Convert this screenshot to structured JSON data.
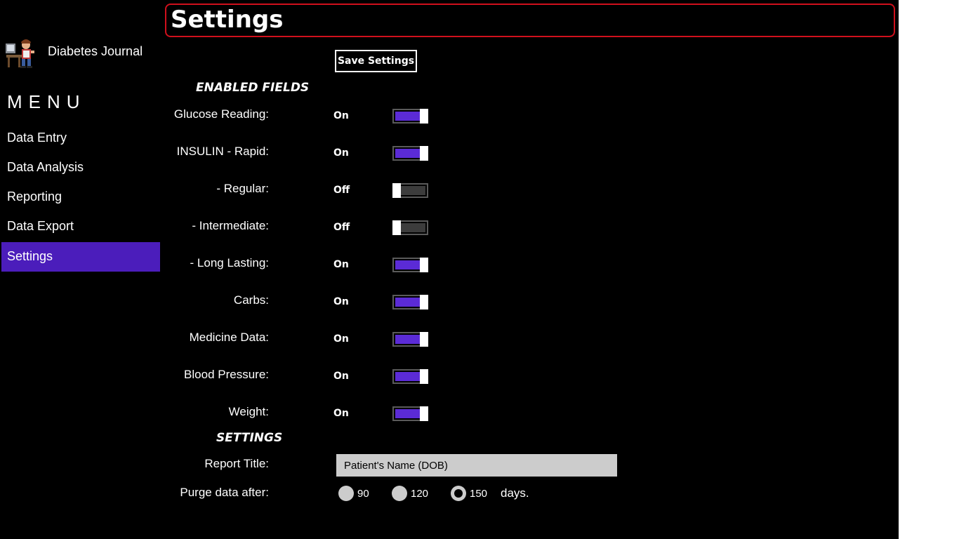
{
  "app": {
    "title": "Diabetes Journal",
    "logo_icon": "person-at-desk-logo"
  },
  "menu": {
    "heading": "MENU",
    "items": [
      {
        "label": "Data Entry",
        "active": false
      },
      {
        "label": "Data Analysis",
        "active": false
      },
      {
        "label": "Reporting",
        "active": false
      },
      {
        "label": "Data Export",
        "active": false
      },
      {
        "label": "Settings",
        "active": true
      }
    ]
  },
  "header": {
    "title": "Settings",
    "border_color": "#d0101c"
  },
  "toolbar": {
    "save_label": "Save Settings"
  },
  "enabled_fields": {
    "heading": "ENABLED FIELDS",
    "fields": [
      {
        "label": "Glucose Reading:",
        "state": "On",
        "on": true
      },
      {
        "label": "INSULIN - Rapid:",
        "state": "On",
        "on": true
      },
      {
        "label": "- Regular:",
        "state": "Off",
        "on": false
      },
      {
        "label": "- Intermediate:",
        "state": "Off",
        "on": false
      },
      {
        "label": "- Long Lasting:",
        "state": "On",
        "on": true
      },
      {
        "label": "Carbs:",
        "state": "On",
        "on": true
      },
      {
        "label": "Medicine Data:",
        "state": "On",
        "on": true
      },
      {
        "label": "Blood Pressure:",
        "state": "On",
        "on": true
      },
      {
        "label": "Weight:",
        "state": "On",
        "on": true
      }
    ]
  },
  "settings": {
    "heading": "SETTINGS",
    "report_title": {
      "label": "Report Title:",
      "value": "Patient's Name (DOB)"
    },
    "purge": {
      "label": "Purge data after:",
      "options": [
        "90",
        "120",
        "150"
      ],
      "selected": "150",
      "suffix": "days."
    }
  },
  "colors": {
    "accent": "#4b1dbb",
    "toggle_on": "#5b2bd6",
    "background": "#000000",
    "input_bg": "#cccccc"
  }
}
